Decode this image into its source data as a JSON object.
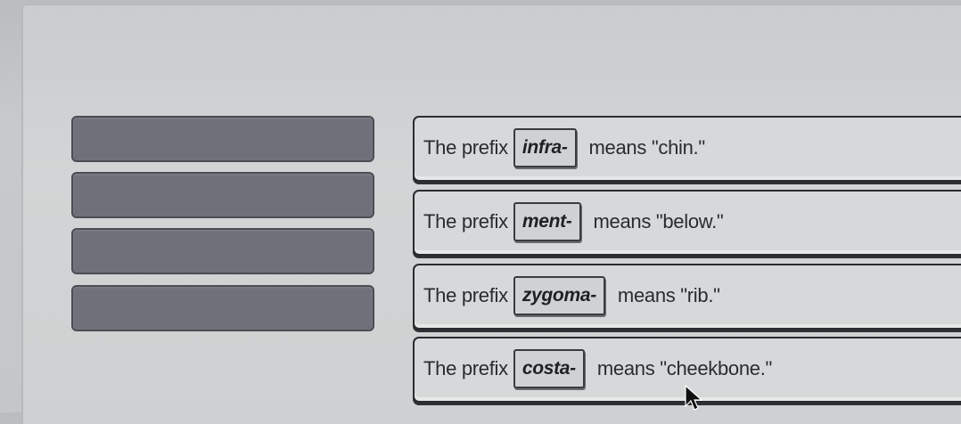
{
  "statements": [
    {
      "lead": "The prefix",
      "prefix": "infra-",
      "meaning": "means \"chin.\""
    },
    {
      "lead": "The prefix",
      "prefix": "ment-",
      "meaning": "means \"below.\""
    },
    {
      "lead": "The prefix",
      "prefix": "zygoma-",
      "meaning": "means \"rib.\""
    },
    {
      "lead": "The prefix",
      "prefix": "costa-",
      "meaning": "means \"cheekbone.\""
    }
  ],
  "answer_slots": [
    "",
    "",
    "",
    ""
  ],
  "colors": {
    "slot_fill": "#6f717a",
    "page_bg": "#cdd0d0",
    "text": "#2a2b2f"
  }
}
